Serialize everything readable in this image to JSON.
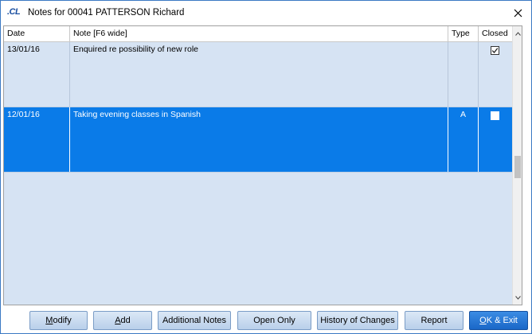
{
  "window": {
    "logo_text": ".CL",
    "title": "Notes for 00041 PATTERSON Richard"
  },
  "grid": {
    "columns": {
      "date": "Date",
      "note": "Note [F6 wide]",
      "type": "Type",
      "closed": "Closed"
    },
    "rows": [
      {
        "date": "13/01/16",
        "note": "Enquired re possibility of new role",
        "type": "",
        "closed": true,
        "selected": false
      },
      {
        "date": "12/01/16",
        "note": "Taking evening classes in Spanish",
        "type": "A",
        "closed": false,
        "selected": true
      }
    ]
  },
  "buttons": {
    "modify": {
      "first": "M",
      "rest": "odify"
    },
    "add": {
      "first": "A",
      "rest": "dd"
    },
    "additional_notes": "Additional Notes",
    "open_only": "Open Only",
    "history": "History of Changes",
    "report": "Report",
    "ok_exit": {
      "first": "O",
      "rest": "K & Exit"
    }
  },
  "colors": {
    "selected_row": "#0a7be8",
    "grid_background": "#d6e3f3",
    "button_gradient_top": "#dbe8f6",
    "button_gradient_bottom": "#b9cfea",
    "primary_button": "#1a67c7"
  },
  "icons": {
    "close": "close-icon",
    "check": "checkmark-icon",
    "scroll_up": "chevron-up-icon",
    "scroll_down": "chevron-down-icon"
  }
}
